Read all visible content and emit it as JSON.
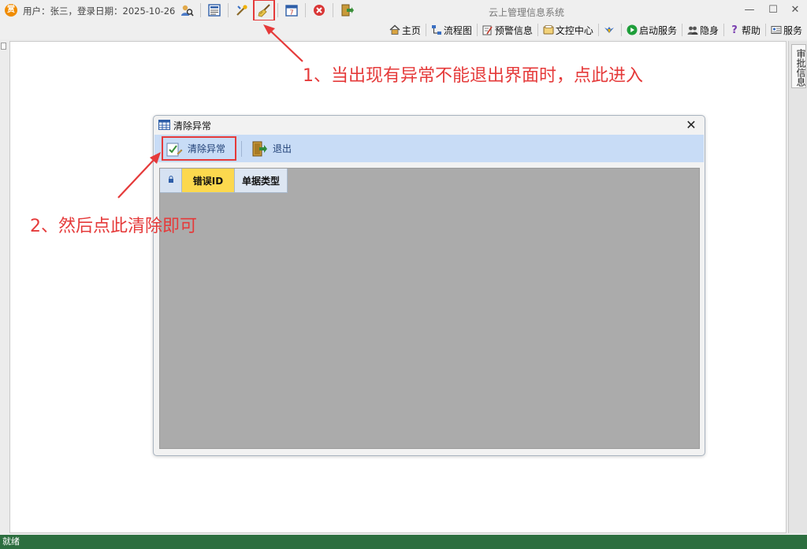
{
  "titlebar": {
    "logo_glyph": "赏",
    "user_info": "用户：张三，登录日期：2025-10-26",
    "app_title": "云上管理信息系统",
    "minimize": "—",
    "maximize": "☐",
    "close": "✕",
    "toolbar_icons": [
      "user-search-icon",
      "form-icon",
      "tools-icon",
      "broom-icon",
      "calendar-icon",
      "stop-icon",
      "exit-door-icon"
    ]
  },
  "menubar": {
    "home": "主页",
    "flow": "流程图",
    "alert": "预警信息",
    "doc_center": "文控中心",
    "start_service": "启动服务",
    "hide": "隐身",
    "help": "帮助",
    "service": "服务"
  },
  "right_panel": {
    "tab": "审批信息"
  },
  "statusbar": {
    "text": "就绪"
  },
  "dialog": {
    "title": "清除异常",
    "close": "✕",
    "clear_button": "清除异常",
    "exit_button": "退出",
    "grid": {
      "columns": [
        "错误ID",
        "单据类型"
      ]
    }
  },
  "annotations": {
    "step1": "1、当出现有异常不能退出界面时，点此进入",
    "step2": "2、然后点此清除即可"
  },
  "colors": {
    "annotation": "#e53a3a",
    "statusbar": "#2c6e3f",
    "dialog_toolbar": "#c8dcf6",
    "active_column": "#fcd84e"
  }
}
